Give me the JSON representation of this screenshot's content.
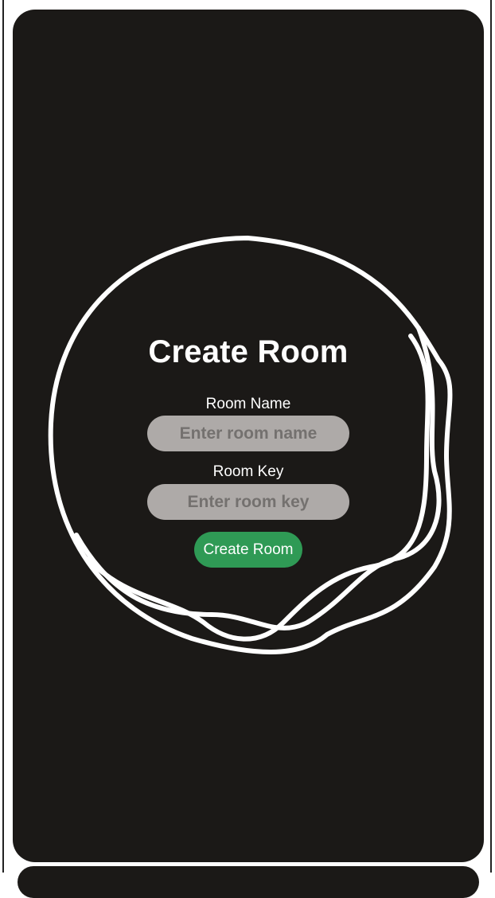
{
  "form": {
    "title": "Create Room",
    "room_name_label": "Room Name",
    "room_name_placeholder": "Enter room name",
    "room_key_label": "Room Key",
    "room_key_placeholder": "Enter room key",
    "submit_label": "Create Room"
  },
  "colors": {
    "card_background": "#1b1917",
    "input_background": "#aeaaa8",
    "button_background": "#2f9a55",
    "text": "#ffffff"
  }
}
